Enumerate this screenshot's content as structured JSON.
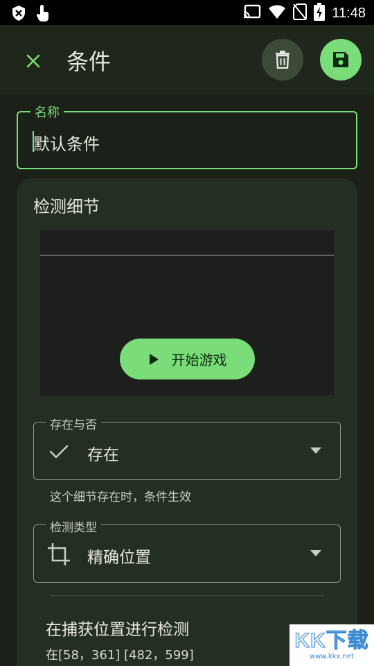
{
  "status_bar": {
    "time": "11:48",
    "icons": [
      "shield-icon",
      "touch-icon",
      "cast-icon",
      "wifi-icon",
      "no-sim-icon",
      "battery-charging-icon"
    ]
  },
  "toolbar": {
    "title": "条件",
    "close_icon": "close-icon",
    "delete_icon": "delete-icon",
    "save_icon": "save-icon"
  },
  "name_field": {
    "label": "名称",
    "value": "默认条件"
  },
  "detail_card": {
    "title": "检测细节",
    "start_button_label": "开始游戏",
    "presence": {
      "label": "存在与否",
      "value": "存在",
      "icon": "check-icon",
      "helper": "这个细节存在时，条件生效"
    },
    "detection_type": {
      "label": "检测类型",
      "value": "精确位置",
      "icon": "crop-icon"
    },
    "detect_area": {
      "title": "在捕获位置进行检测",
      "subtitle": "在[58，361] [482，599]"
    }
  },
  "watermark": {
    "text": "KK下载",
    "url": "www.kkx.net"
  },
  "colors": {
    "accent": "#7bdd7a",
    "background": "#1b2118",
    "card": "#252e22",
    "appbar": "#1f261c"
  }
}
